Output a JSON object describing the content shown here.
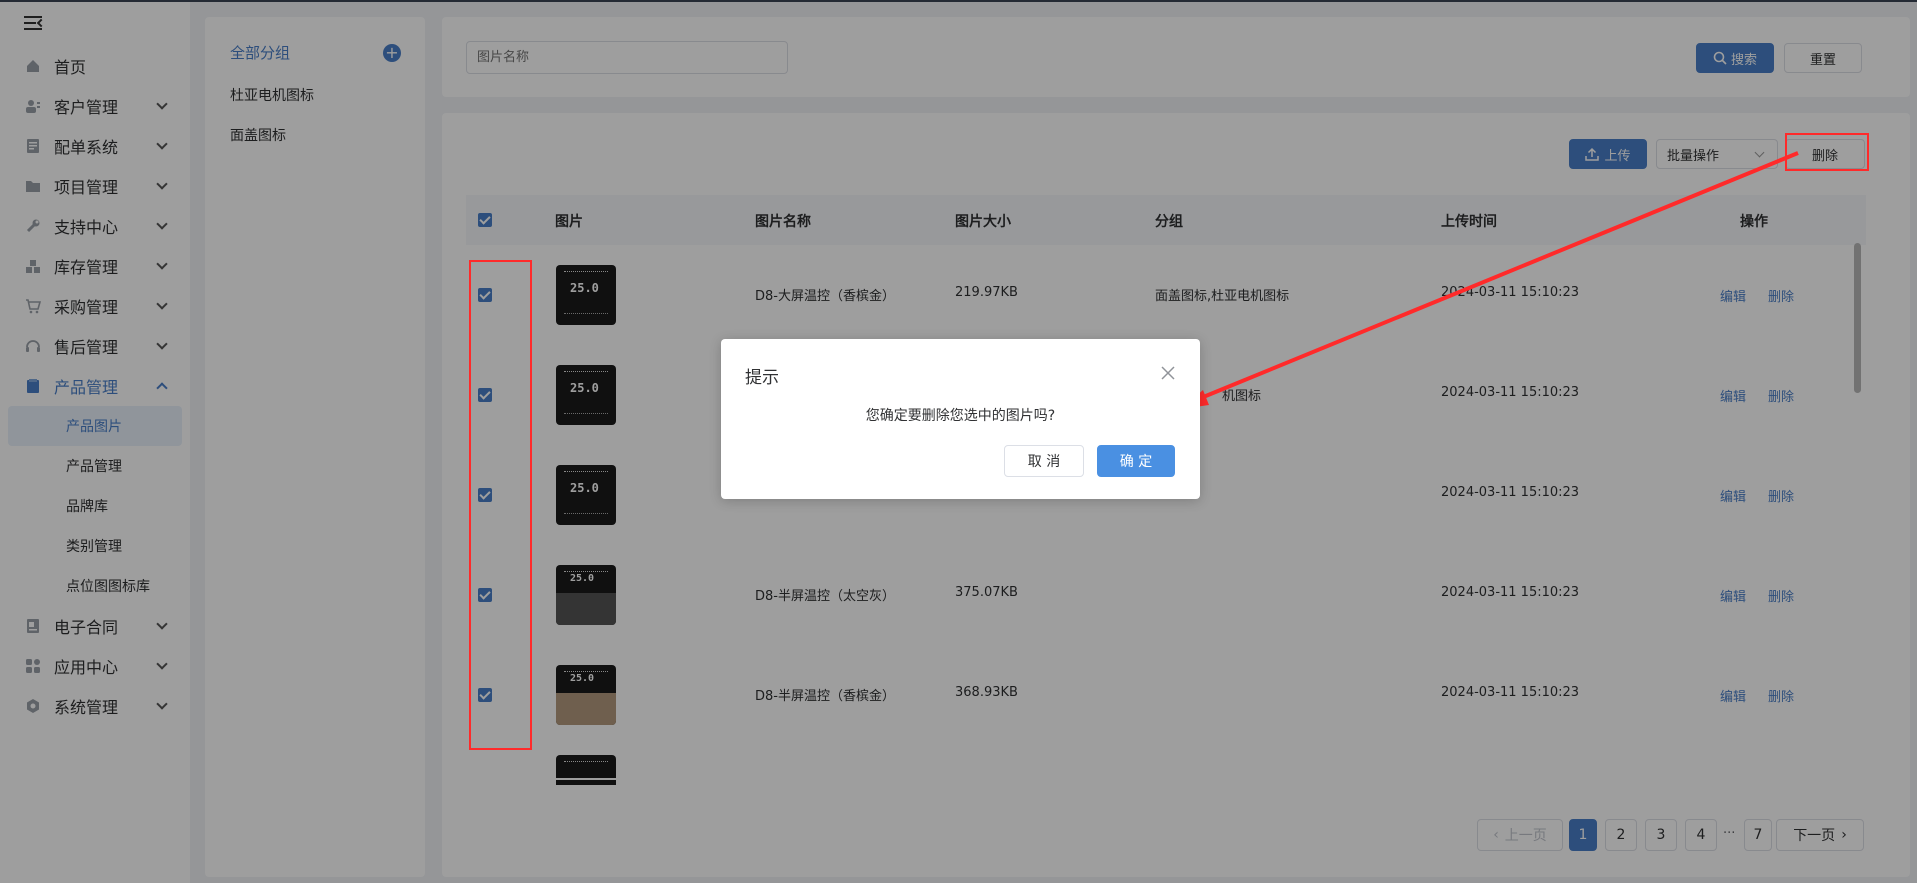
{
  "sidebar": {
    "items": [
      {
        "label": "首页",
        "icon": "home-icon"
      },
      {
        "label": "客户管理",
        "icon": "customer-icon"
      },
      {
        "label": "配单系统",
        "icon": "order-icon"
      },
      {
        "label": "项目管理",
        "icon": "folder-icon"
      },
      {
        "label": "支持中心",
        "icon": "wrench-icon"
      },
      {
        "label": "库存管理",
        "icon": "inventory-icon"
      },
      {
        "label": "采购管理",
        "icon": "cart-icon"
      },
      {
        "label": "售后管理",
        "icon": "headset-icon"
      },
      {
        "label": "产品管理",
        "icon": "product-icon"
      },
      {
        "label": "电子合同",
        "icon": "contract-icon"
      },
      {
        "label": "应用中心",
        "icon": "apps-icon"
      },
      {
        "label": "系统管理",
        "icon": "settings-icon"
      }
    ],
    "sub_items": [
      "产品图片",
      "产品管理",
      "品牌库",
      "类别管理",
      "点位图图标库"
    ]
  },
  "groups": {
    "all_label": "全部分组",
    "add_icon": "+",
    "items": [
      "杜亚电机图标",
      "面盖图标"
    ]
  },
  "search": {
    "placeholder": "图片名称",
    "search_label": "搜索",
    "reset_label": "重置"
  },
  "toolbar": {
    "upload_label": "上传",
    "batch_label": "批量操作",
    "delete_label": "删除"
  },
  "table": {
    "headers": [
      "图片",
      "图片名称",
      "图片大小",
      "分组",
      "上传时间",
      "操作"
    ],
    "rows": [
      {
        "screen": "25.0",
        "name": "D8-大屏温控（香槟金）",
        "size": "219.97KB",
        "group": "面盖图标,杜亚电机图标",
        "time": "2024-03-11 15:10:23",
        "edit": "编辑",
        "del": "删除"
      },
      {
        "screen": "25.0",
        "name": "",
        "size": "",
        "group": "机图标",
        "time": "2024-03-11 15:10:23",
        "edit": "编辑",
        "del": "删除"
      },
      {
        "screen": "25.0",
        "name": "",
        "size": "",
        "group": "",
        "time": "2024-03-11 15:10:23",
        "edit": "编辑",
        "del": "删除"
      },
      {
        "screen": "25.0",
        "name": "D8-半屏温控（太空灰）",
        "size": "375.07KB",
        "group": "",
        "time": "2024-03-11 15:10:23",
        "edit": "编辑",
        "del": "删除"
      },
      {
        "screen": "25.0",
        "name": "D8-半屏温控（香槟金）",
        "size": "368.93KB",
        "group": "",
        "time": "2024-03-11 15:10:23",
        "edit": "编辑",
        "del": "删除"
      }
    ]
  },
  "pagination": {
    "prev": "上一页",
    "pages": [
      "1",
      "2",
      "3",
      "4"
    ],
    "ellipsis": "···",
    "last": "7",
    "next": "下一页"
  },
  "dialog": {
    "title": "提示",
    "message": "您确定要删除您选中的图片吗?",
    "cancel": "取 消",
    "confirm": "确 定"
  },
  "colors": {
    "accent": "#4a7fc8",
    "annotation": "#ff2a2a"
  }
}
